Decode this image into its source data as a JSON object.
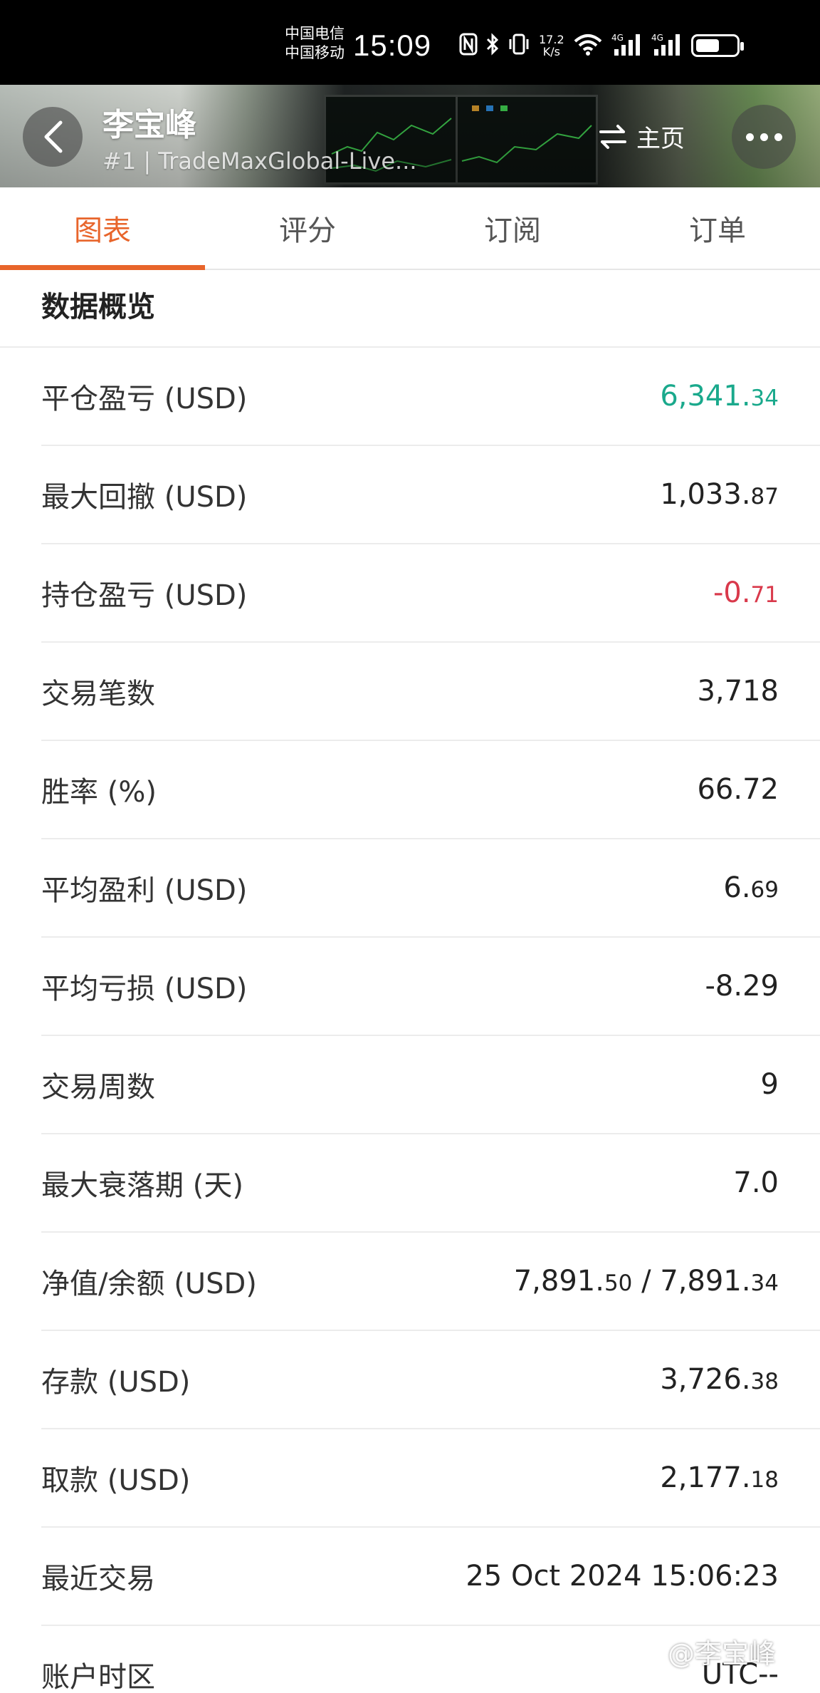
{
  "status_bar": {
    "carrier_1": "中国电信",
    "carrier_2": "中国移动",
    "time": "15:09",
    "net_speed_value": "17.2",
    "net_speed_unit": "K/s",
    "signal_1_label": "4G",
    "signal_2_label": "4G",
    "icons": [
      "nfc-icon",
      "bluetooth-icon",
      "vibrate-icon",
      "wifi-icon",
      "signal-icon",
      "signal-icon",
      "battery-icon"
    ]
  },
  "header": {
    "name": "李宝峰",
    "subtitle": "#1 | TradeMaxGlobal-Live...",
    "home_label": "主页"
  },
  "tabs": [
    {
      "label": "图表",
      "active": true
    },
    {
      "label": "评分",
      "active": false
    },
    {
      "label": "订阅",
      "active": false
    },
    {
      "label": "订单",
      "active": false
    }
  ],
  "overview": {
    "title": "数据概览",
    "rows": [
      {
        "label": "平仓盈亏 (USD)",
        "main": "6,341.",
        "small": "34",
        "color": "#1aa98c"
      },
      {
        "label": "最大回撤 (USD)",
        "main": "1,033.",
        "small": "87"
      },
      {
        "label": "持仓盈亏 (USD)",
        "main": "-0.",
        "small": "71",
        "color": "#d9394b"
      },
      {
        "label": "交易笔数",
        "main": "3,718",
        "small": ""
      },
      {
        "label": "胜率 (%)",
        "main": "66.72",
        "small": ""
      },
      {
        "label": "平均盈利 (USD)",
        "main": "6.",
        "small": "69"
      },
      {
        "label": "平均亏损 (USD)",
        "main": "-8.29",
        "small": ""
      },
      {
        "label": "交易周数",
        "main": "9",
        "small": ""
      },
      {
        "label": "最大衰落期 (天)",
        "main": "7.0",
        "small": ""
      },
      {
        "label": "净值/余额 (USD)",
        "main": "7,891.",
        "small": "50",
        "main2": " / 7,891.",
        "small2": "34"
      },
      {
        "label": "存款 (USD)",
        "main": "3,726.",
        "small": "38"
      },
      {
        "label": "取款 (USD)",
        "main": "2,177.",
        "small": "18"
      },
      {
        "label": "最近交易",
        "main": "25 Oct 2024 15:06:23",
        "small": ""
      },
      {
        "label": "账户时区",
        "main": "UTC--",
        "small": ""
      }
    ]
  },
  "watermark": "@李宝峰",
  "colors": {
    "accent": "#e8652b",
    "profit": "#1aa98c",
    "loss": "#d9394b"
  }
}
